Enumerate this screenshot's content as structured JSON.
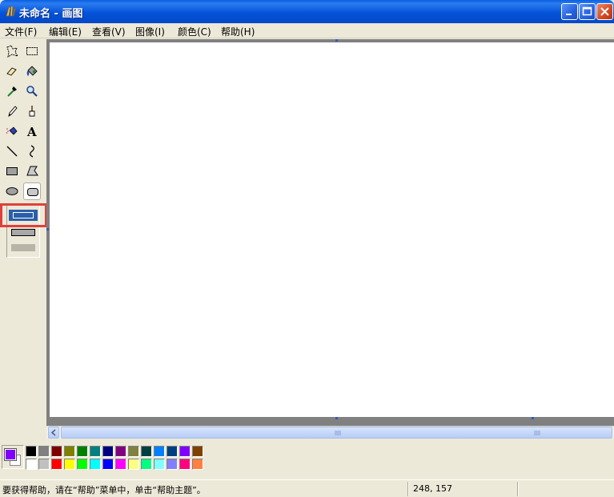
{
  "window": {
    "title": "未命名 - 画图"
  },
  "menu": {
    "items": [
      {
        "label": "文件(F)"
      },
      {
        "label": "编辑(E)"
      },
      {
        "label": "查看(V)"
      },
      {
        "label": "图像(I)"
      },
      {
        "label": "颜色(C)"
      },
      {
        "label": "帮助(H)"
      }
    ]
  },
  "toolbox": {
    "tools": [
      {
        "name": "free-form-select-icon"
      },
      {
        "name": "rect-select-icon"
      },
      {
        "name": "eraser-icon"
      },
      {
        "name": "fill-bucket-icon"
      },
      {
        "name": "color-picker-icon"
      },
      {
        "name": "magnifier-icon"
      },
      {
        "name": "pencil-icon"
      },
      {
        "name": "brush-icon"
      },
      {
        "name": "airbrush-icon"
      },
      {
        "name": "text-icon",
        "glyph": "A"
      },
      {
        "name": "line-icon"
      },
      {
        "name": "curve-icon"
      },
      {
        "name": "rectangle-icon"
      },
      {
        "name": "polygon-icon"
      },
      {
        "name": "ellipse-icon"
      },
      {
        "name": "rounded-rectangle-icon",
        "selected": true
      }
    ],
    "fill_options": [
      "outline-only",
      "outline-and-fill",
      "fill-only"
    ],
    "selected_fill_option": "outline-only"
  },
  "palette": {
    "foreground": "#8000ff",
    "background": "#ffffff",
    "row1": [
      "#000000",
      "#808080",
      "#800000",
      "#808000",
      "#008000",
      "#008080",
      "#000080",
      "#800080",
      "#808040",
      "#004040",
      "#0080ff",
      "#004080",
      "#8000ff",
      "#804000"
    ],
    "row2": [
      "#ffffff",
      "#c0c0c0",
      "#ff0000",
      "#ffff00",
      "#00ff00",
      "#00ffff",
      "#0000ff",
      "#ff00ff",
      "#ffff80",
      "#00ff80",
      "#80ffff",
      "#8080ff",
      "#ff0080",
      "#ff8040"
    ]
  },
  "status": {
    "message": "要获得帮助，请在“帮助”菜单中，单击“帮助主题”。",
    "coords": "248, 157"
  },
  "annotation": {
    "highlight_color": "#e0403c"
  }
}
